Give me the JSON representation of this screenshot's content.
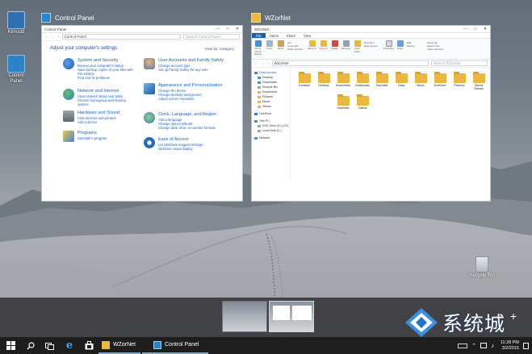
{
  "colors": {
    "accent": "#1e64c8",
    "taskbar": "#1e1e1e",
    "strip": "#3a3a3e",
    "folder": "#e9b83d"
  },
  "desktop_icons": [
    {
      "label": "Kimodd",
      "icon": "pc-icon"
    },
    {
      "label": "Control Panel",
      "icon": "control-panel-icon"
    },
    {
      "label": "Recycle Bin",
      "icon": "recycle-bin-icon"
    }
  ],
  "task_view": {
    "control_panel": {
      "title": "Control Panel",
      "window_title": "Control Panel",
      "address": "Control Panel",
      "search_placeholder": "Search Control Panel",
      "heading": "Adjust your computer's settings",
      "view_by_label": "View by:",
      "view_by_value": "Category",
      "categories": [
        {
          "name": "System and Security",
          "links": [
            "Review your computer's status",
            "Save backup copies of your files with File History",
            "Find and fix problems"
          ]
        },
        {
          "name": "Network and Internet",
          "links": [
            "View network status and tasks",
            "Choose homegroup and sharing options"
          ]
        },
        {
          "name": "Hardware and Sound",
          "links": [
            "View devices and printers",
            "Add a device"
          ]
        },
        {
          "name": "Programs",
          "links": [
            "Uninstall a program"
          ]
        },
        {
          "name": "User Accounts and Family Safety",
          "links": [
            "Change account type",
            "Set up Family Safety for any user"
          ]
        },
        {
          "name": "Appearance and Personalization",
          "links": [
            "Change the theme",
            "Change desktop background",
            "Adjust screen resolution"
          ]
        },
        {
          "name": "Clock, Language, and Region",
          "links": [
            "Add a language",
            "Change input methods",
            "Change date, time, or number formats"
          ]
        },
        {
          "name": "Ease of Access",
          "links": [
            "Let Windows suggest settings",
            "Optimize visual display"
          ]
        }
      ]
    },
    "explorer": {
      "title": "WZorNet",
      "window_title": "WZorNet",
      "address": "WZorNet",
      "search_placeholder": "Search WZorNet",
      "tabs": [
        "File",
        "Home",
        "Share",
        "View"
      ],
      "ribbon_buttons": [
        "Pin to Quick access",
        "Copy",
        "Paste",
        "Move to",
        "Copy to",
        "Delete",
        "Rename",
        "New folder",
        "Properties",
        "Open"
      ],
      "ribbon_small": [
        "Cut",
        "Copy path",
        "Paste shortcut",
        "New item",
        "Easy access",
        "Edit",
        "History",
        "Select all",
        "Select none",
        "Invert selection"
      ],
      "nav_pane": [
        "Quick access",
        "Desktop",
        "Downloads",
        "Recycle Bin",
        "Documents",
        "Pictures",
        "Music",
        "Videos",
        "OneDrive",
        "This PC",
        "DVD Drive (D:) LCO",
        "Local Disk (C:)",
        "Network"
      ],
      "files": [
        "Contacts",
        "Desktop",
        "Documents",
        "Downloads",
        "Favorites",
        "Links",
        "Music",
        "OneDrive",
        "Pictures",
        "Saved Games",
        "Searches",
        "Videos"
      ]
    }
  },
  "taskbar": {
    "tasks": [
      "WZorNet",
      "Control Panel"
    ],
    "time": "11:28 PM",
    "date": "3/2/2015"
  },
  "watermark": {
    "text": "系统城"
  }
}
